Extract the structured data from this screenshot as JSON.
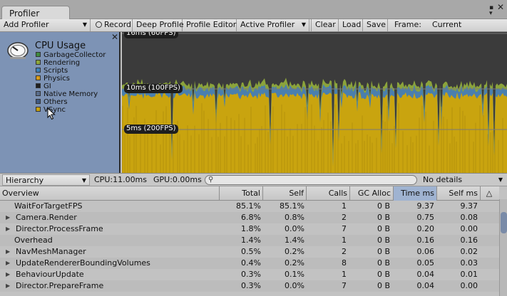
{
  "window": {
    "title": "Profiler",
    "menu_icon": "window-menu-icon",
    "close_glyph": "✕"
  },
  "toolbar": {
    "add_profiler": "Add Profiler",
    "record": "Record",
    "deep_profile": "Deep Profile",
    "profile_editor": "Profile Editor",
    "active_profiler": "Active Profiler",
    "clear": "Clear",
    "load": "Load",
    "save": "Save",
    "frame_label": "Frame:",
    "frame_value": "Current"
  },
  "cpu_panel": {
    "title": "CPU Usage",
    "legend": [
      {
        "label": "GarbageCollector",
        "color": "#3f8a3f"
      },
      {
        "label": "Rendering",
        "color": "#8ca63a"
      },
      {
        "label": "Scripts",
        "color": "#3b7fb7"
      },
      {
        "label": "Physics",
        "color": "#d69a1a"
      },
      {
        "label": "GI",
        "color": "#1f1f1f"
      },
      {
        "label": "Native Memory",
        "color": "#5a6e8c"
      },
      {
        "label": "Others",
        "color": "#405a82"
      },
      {
        "label": "VSync",
        "color": "#c6a010"
      }
    ]
  },
  "graph": {
    "fps_labels": [
      "16ms (60FPS)",
      "10ms (100FPS)",
      "5ms (200FPS)"
    ],
    "colors": {
      "background": "#3b3b3b",
      "vsync": "#c9a40f",
      "scripts": "#4a7fae",
      "rendering": "#8ba33b",
      "gridline": "#7a7a7a"
    }
  },
  "hierarchy_bar": {
    "view_mode": "Hierarchy",
    "cpu_time": "CPU:11.00ms",
    "gpu_time": "GPU:0.00ms",
    "search_placeholder": "",
    "details": "No details"
  },
  "table": {
    "columns": [
      "Overview",
      "Total",
      "Self",
      "Calls",
      "GC Alloc",
      "Time ms",
      "Self ms"
    ],
    "sorted_column": "Time ms",
    "rows": [
      {
        "name": "WaitForTargetFPS",
        "expandable": false,
        "total": "85.1%",
        "self": "85.1%",
        "calls": "1",
        "gc_alloc": "0 B",
        "time_ms": "9.37",
        "self_ms": "9.37"
      },
      {
        "name": "Camera.Render",
        "expandable": true,
        "total": "6.8%",
        "self": "0.8%",
        "calls": "2",
        "gc_alloc": "0 B",
        "time_ms": "0.75",
        "self_ms": "0.08"
      },
      {
        "name": "Director.ProcessFrame",
        "expandable": true,
        "total": "1.8%",
        "self": "0.0%",
        "calls": "7",
        "gc_alloc": "0 B",
        "time_ms": "0.20",
        "self_ms": "0.00"
      },
      {
        "name": "Overhead",
        "expandable": false,
        "total": "1.4%",
        "self": "1.4%",
        "calls": "1",
        "gc_alloc": "0 B",
        "time_ms": "0.16",
        "self_ms": "0.16"
      },
      {
        "name": "NavMeshManager",
        "expandable": true,
        "total": "0.5%",
        "self": "0.2%",
        "calls": "2",
        "gc_alloc": "0 B",
        "time_ms": "0.06",
        "self_ms": "0.02"
      },
      {
        "name": "UpdateRendererBoundingVolumes",
        "expandable": true,
        "total": "0.4%",
        "self": "0.2%",
        "calls": "8",
        "gc_alloc": "0 B",
        "time_ms": "0.05",
        "self_ms": "0.03"
      },
      {
        "name": "BehaviourUpdate",
        "expandable": true,
        "total": "0.3%",
        "self": "0.1%",
        "calls": "1",
        "gc_alloc": "0 B",
        "time_ms": "0.04",
        "self_ms": "0.01"
      },
      {
        "name": "Director.PrepareFrame",
        "expandable": true,
        "total": "0.3%",
        "self": "0.0%",
        "calls": "7",
        "gc_alloc": "0 B",
        "time_ms": "0.04",
        "self_ms": "0.00"
      }
    ]
  }
}
